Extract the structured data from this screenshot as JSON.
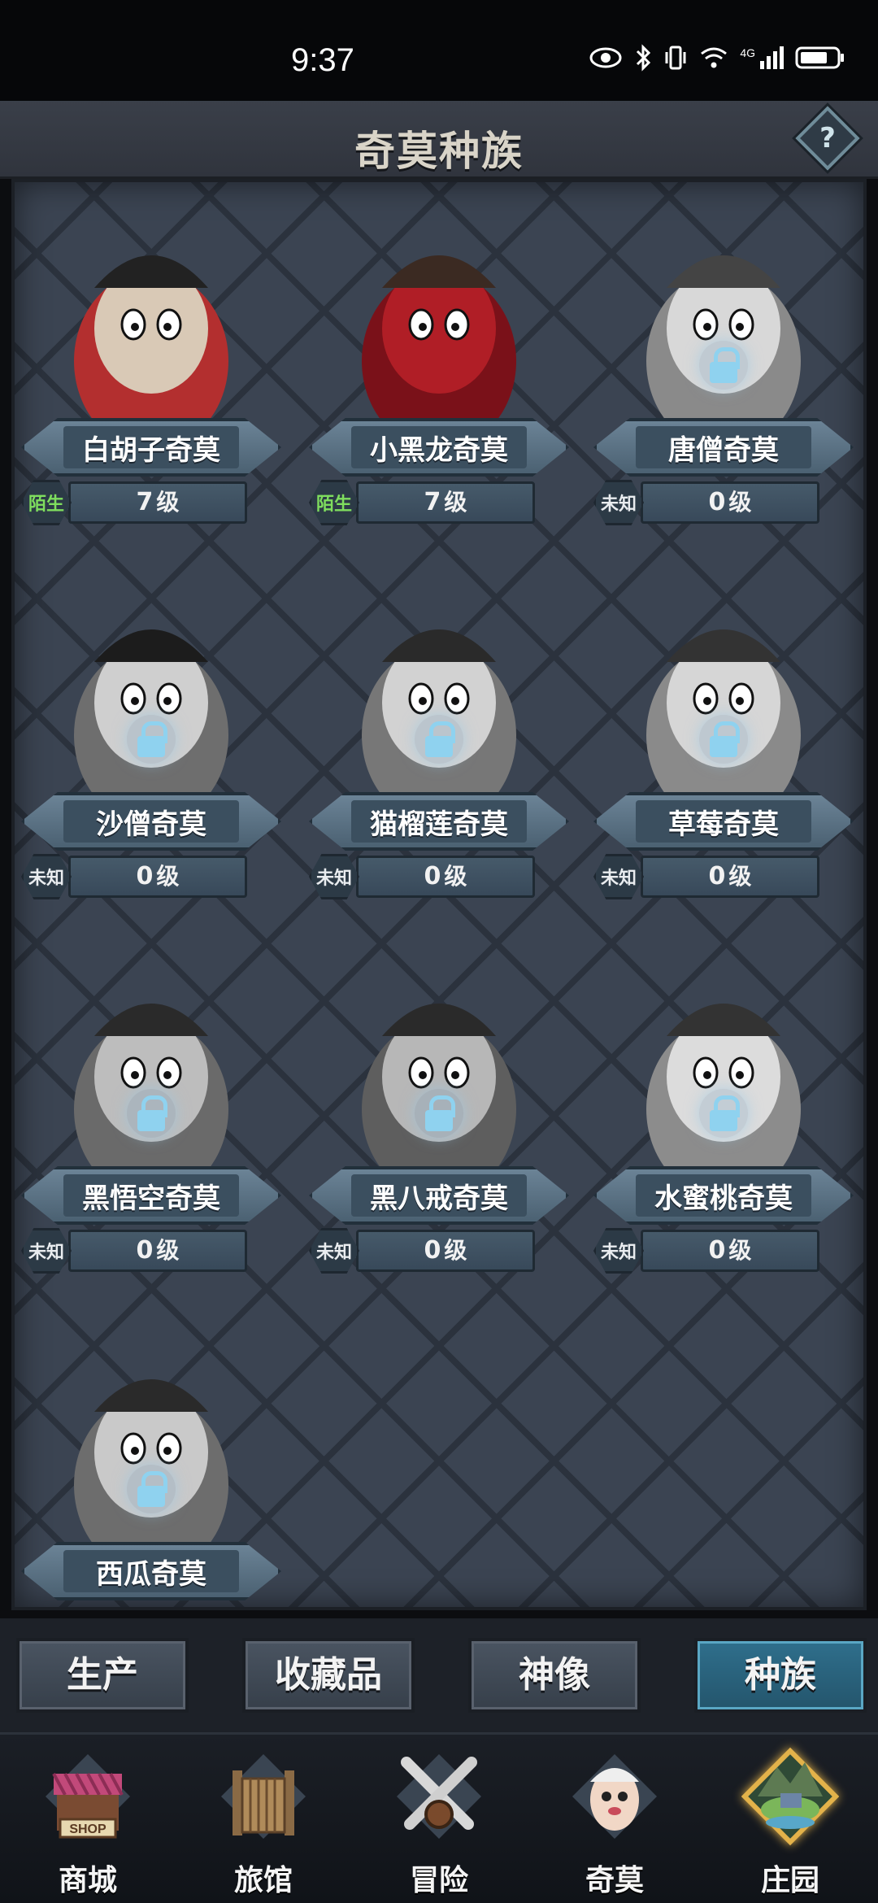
{
  "status_bar": {
    "time": "9:37",
    "network": "4G"
  },
  "header": {
    "title": "奇莫种族",
    "help_label": "?"
  },
  "cards": [
    {
      "name": "白胡子奇莫",
      "status": "陌生",
      "level": "7",
      "level_unit": "级",
      "locked": false
    },
    {
      "name": "小黑龙奇莫",
      "status": "陌生",
      "level": "7",
      "level_unit": "级",
      "locked": false
    },
    {
      "name": "唐僧奇莫",
      "status": "未知",
      "level": "0",
      "level_unit": "级",
      "locked": true
    },
    {
      "name": "沙僧奇莫",
      "status": "未知",
      "level": "0",
      "level_unit": "级",
      "locked": true
    },
    {
      "name": "猫榴莲奇莫",
      "status": "未知",
      "level": "0",
      "level_unit": "级",
      "locked": true
    },
    {
      "name": "草莓奇莫",
      "status": "未知",
      "level": "0",
      "level_unit": "级",
      "locked": true
    },
    {
      "name": "黑悟空奇莫",
      "status": "未知",
      "level": "0",
      "level_unit": "级",
      "locked": true
    },
    {
      "name": "黑八戒奇莫",
      "status": "未知",
      "level": "0",
      "level_unit": "级",
      "locked": true
    },
    {
      "name": "水蜜桃奇莫",
      "status": "未知",
      "level": "0",
      "level_unit": "级",
      "locked": true
    },
    {
      "name": "西瓜奇莫",
      "locked": true
    }
  ],
  "tabs": [
    "生产",
    "收藏品",
    "神像",
    "种族"
  ],
  "active_tab": "种族",
  "nav": [
    {
      "label": "商城",
      "icon": "shop-icon",
      "sign": "SHOP"
    },
    {
      "label": "旅馆",
      "icon": "inn-icon"
    },
    {
      "label": "冒险",
      "icon": "crossed-swords-icon"
    },
    {
      "label": "奇莫",
      "icon": "qimo-character-icon"
    },
    {
      "label": "庄园",
      "icon": "manor-island-icon"
    }
  ],
  "active_nav": "庄园",
  "colors": {
    "known_status": "#7fde5e",
    "active_tab": "#2f6f8c",
    "panel_bg": "#3b4452"
  }
}
